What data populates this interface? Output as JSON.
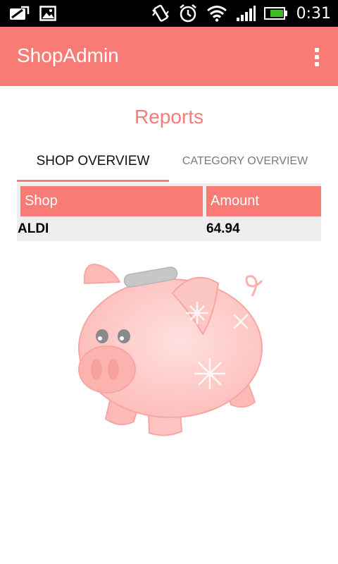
{
  "status_bar": {
    "time": "0:31",
    "left_icons": [
      "gallery-sync-icon",
      "image-icon"
    ],
    "right_icons": [
      "vibrate-icon",
      "alarm-icon",
      "wifi-icon",
      "signal-icon",
      "battery-icon"
    ]
  },
  "app_bar": {
    "title": "ShopAdmin",
    "menu_icon": "overflow-menu-icon"
  },
  "page": {
    "title": "Reports"
  },
  "tabs": [
    {
      "label": "SHOP OVERVIEW",
      "selected": true
    },
    {
      "label": "CATEGORY OVERVIEW",
      "selected": false
    }
  ],
  "table": {
    "headers": [
      "Shop",
      "Amount"
    ],
    "rows": [
      {
        "shop": "ALDI",
        "amount": "64.94"
      }
    ]
  },
  "colors": {
    "accent": "#f97b76",
    "row_bg": "#eeeeee",
    "status_bar": "#000000"
  }
}
